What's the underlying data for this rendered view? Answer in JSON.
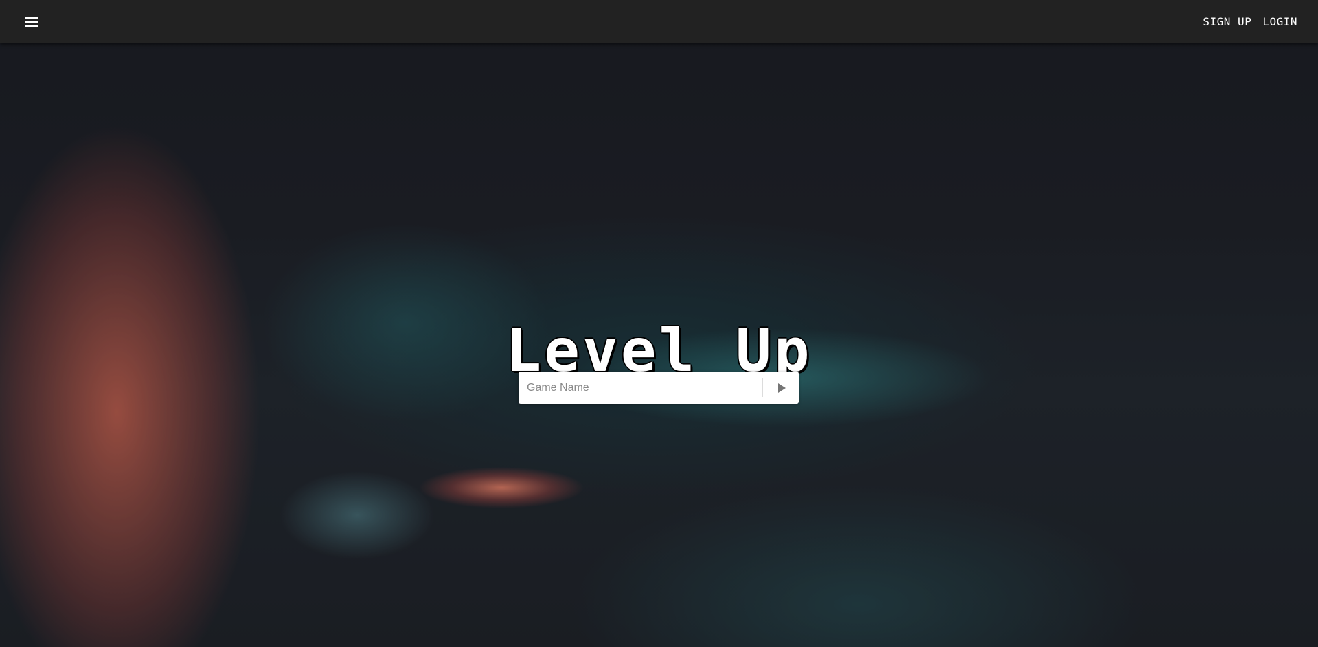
{
  "topbar": {
    "menu_icon": "hamburger-menu-icon",
    "signup_label": "SIGN UP",
    "login_label": "LOGIN",
    "background_color": "#222222"
  },
  "hero": {
    "title": "Level Up",
    "background_image": "blurred game controller photo"
  },
  "search": {
    "placeholder": "Game Name",
    "value": "",
    "submit_icon": "play-arrow-icon"
  }
}
